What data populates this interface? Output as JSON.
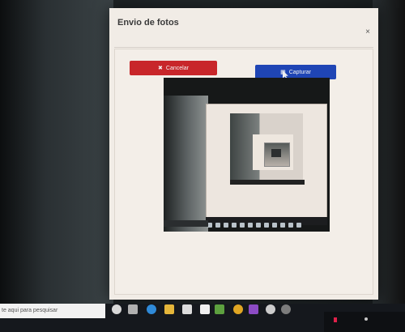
{
  "dialog": {
    "title": "Envio de fotos",
    "close_glyph": "×",
    "cancel_button": {
      "label": "Cancelar",
      "icon": "close-icon",
      "color": "#c8262a"
    },
    "capture_button": {
      "label": "Capturar",
      "icon": "camera-icon",
      "color": "#1f45b5"
    }
  },
  "taskbar": {
    "search_placeholder": "te aqui para pesquisar",
    "apps": [
      "start-icon",
      "task-view-icon",
      "edge-icon",
      "file-explorer-icon",
      "store-icon",
      "mail-icon",
      "android-studio-icon",
      "chrome-icon",
      "visual-studio-icon",
      "settings-icon",
      "app-icon"
    ]
  }
}
